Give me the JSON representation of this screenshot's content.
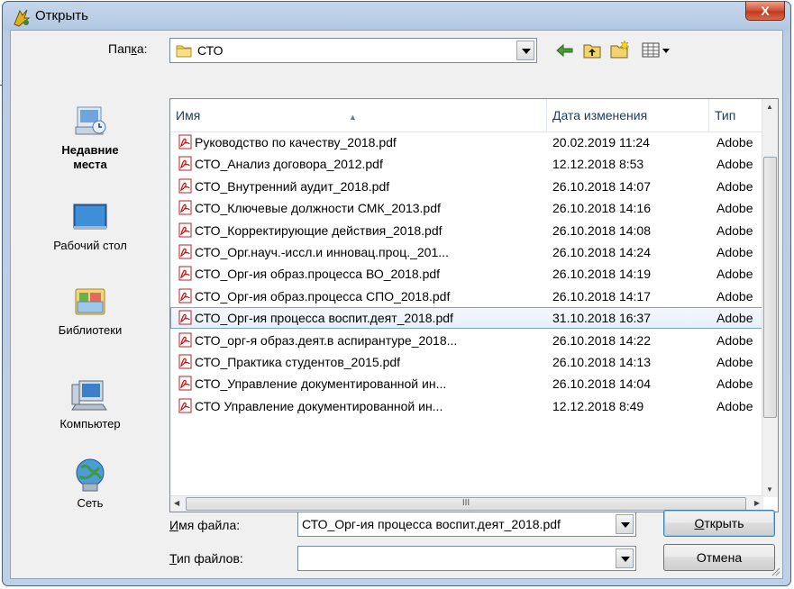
{
  "window": {
    "title": "Открыть",
    "close_label": "X"
  },
  "folder": {
    "label_pre": "Пап",
    "label_u": "к",
    "label_post": "а:",
    "value": "СТО"
  },
  "places": [
    {
      "label": "Недавние места",
      "icon": "recent-places-icon"
    },
    {
      "label": "Рабочий стол",
      "icon": "desktop-icon"
    },
    {
      "label": "Библиотеки",
      "icon": "libraries-icon"
    },
    {
      "label": "Компьютер",
      "icon": "computer-icon"
    },
    {
      "label": "Сеть",
      "icon": "network-icon"
    }
  ],
  "columns": {
    "name": "Имя",
    "date": "Дата изменения",
    "type": "Тип"
  },
  "files": [
    {
      "name": "Руководство по качеству_2018.pdf",
      "date": "20.02.2019 11:24",
      "type": "Adobe"
    },
    {
      "name": "СТО_Анализ договора_2012.pdf",
      "date": "12.12.2018 8:53",
      "type": "Adobe"
    },
    {
      "name": "СТО_Внутренний аудит_2018.pdf",
      "date": "26.10.2018 14:07",
      "type": "Adobe"
    },
    {
      "name": "СТО_Ключевые должности СМК_2013.pdf",
      "date": "26.10.2018 14:16",
      "type": "Adobe"
    },
    {
      "name": "СТО_Корректирующие действия_2018.pdf",
      "date": "26.10.2018 14:08",
      "type": "Adobe"
    },
    {
      "name": "СТО_Орг.науч.-иссл.и инновац.проц._201...",
      "date": "26.10.2018 14:24",
      "type": "Adobe"
    },
    {
      "name": "СТО_Орг-ия образ.процесса ВО_2018.pdf",
      "date": "26.10.2018 14:19",
      "type": "Adobe"
    },
    {
      "name": "СТО_Орг-ия образ.процесса СПО_2018.pdf",
      "date": "26.10.2018 14:17",
      "type": "Adobe"
    },
    {
      "name": "СТО_Орг-ия процесса воспит.деят_2018.pdf",
      "date": "31.10.2018 16:37",
      "type": "Adobe"
    },
    {
      "name": "СТО_орг-я образ.деят.в аспирантуре_2018...",
      "date": "26.10.2018 14:22",
      "type": "Adobe"
    },
    {
      "name": "СТО_Практика студентов_2015.pdf",
      "date": "26.10.2018 14:13",
      "type": "Adobe"
    },
    {
      "name": "СТО_Управление документированной ин...",
      "date": "26.10.2018 14:04",
      "type": "Adobe"
    },
    {
      "name": "СТО Управление документированной ин...",
      "date": "12.12.2018 8:49",
      "type": "Adobe"
    }
  ],
  "selected_index": 8,
  "hscroll_grip": "III",
  "filename": {
    "label_u": "И",
    "label_rest": "мя файла:",
    "value": "СТО_Орг-ия процесса воспит.деят_2018.pdf"
  },
  "filetype": {
    "label_u": "Т",
    "label_rest": "ип файлов:",
    "value": ""
  },
  "buttons": {
    "open_u": "О",
    "open_rest": "ткрыть",
    "cancel": "Отмена"
  },
  "colors": {
    "selection_border": "#7da2ce",
    "title_bar": "#b9cde4",
    "close_button": "#c2391c"
  }
}
